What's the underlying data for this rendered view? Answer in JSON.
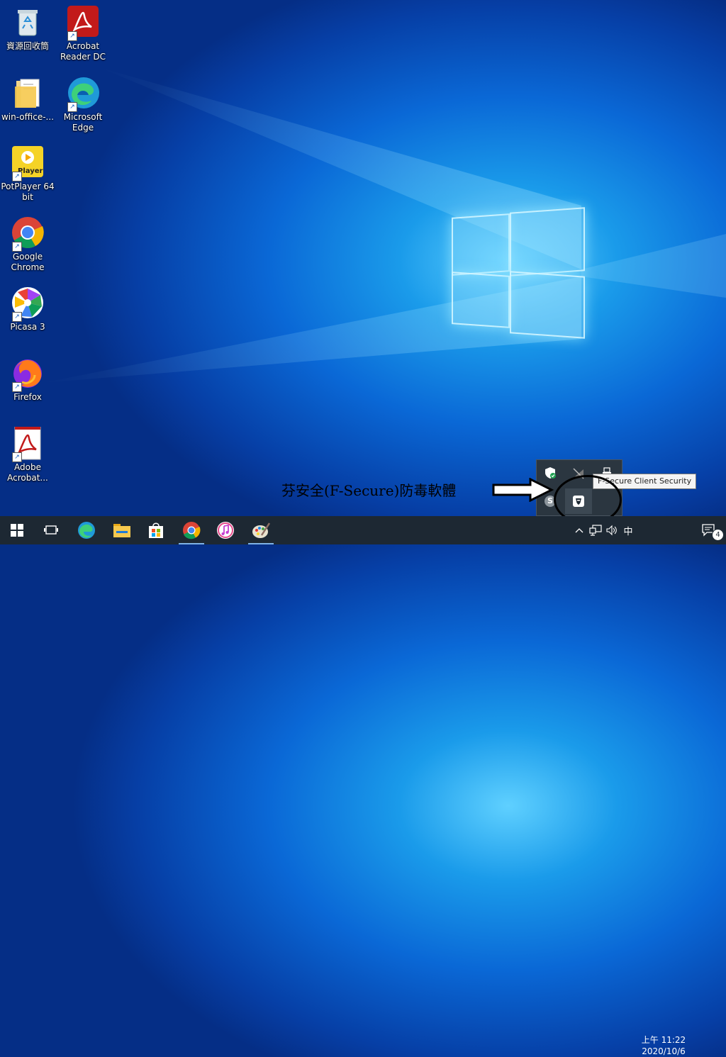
{
  "desktop": {
    "icons": [
      {
        "label": "資源回收筒",
        "icon": "recycle-bin-icon"
      },
      {
        "label": "Acrobat Reader DC",
        "icon": "acrobat-reader-icon"
      },
      {
        "label": "win-office-...",
        "icon": "folder-icon"
      },
      {
        "label": "Microsoft Edge",
        "icon": "edge-icon"
      },
      {
        "label": "PotPlayer 64 bit",
        "icon": "potplayer-icon",
        "badge": "Player"
      },
      {
        "label": "Google Chrome",
        "icon": "chrome-icon"
      },
      {
        "label": "Picasa 3",
        "icon": "picasa-icon"
      },
      {
        "label": "Firefox",
        "icon": "firefox-icon"
      },
      {
        "label": "Adobe Acrobat...",
        "icon": "adobe-acrobat-icon"
      }
    ]
  },
  "annotation": {
    "text": "芬安全(F-Secure)防毒軟體"
  },
  "tray_popup": {
    "tooltip": "F-Secure Client Security",
    "skype_letter": "S"
  },
  "taskbar": {
    "apps": [
      "start-icon",
      "task-view-icon",
      "edge-icon",
      "file-explorer-icon",
      "store-icon",
      "chrome-icon",
      "itunes-icon",
      "paint-icon"
    ],
    "ime": "中",
    "time": "上午 11:22",
    "date": "2020/10/6",
    "notification_count": "4"
  },
  "colors": {
    "taskbar": "#1d2833",
    "desktop_accent": "#0a68d6"
  }
}
